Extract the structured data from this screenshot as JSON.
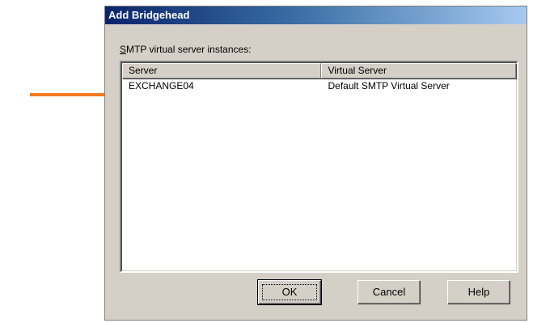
{
  "dialog": {
    "title": "Add Bridgehead",
    "list_caption_accel": "S",
    "list_caption_rest": "MTP virtual server instances:",
    "columns": [
      "Server",
      "Virtual Server"
    ],
    "rows": [
      {
        "server": "EXCHANGE04",
        "virtual_server": "Default SMTP Virtual Server"
      }
    ],
    "buttons": {
      "ok": "OK",
      "cancel": "Cancel",
      "help": "Help"
    }
  },
  "colors": {
    "annotation_arrow": "#f47b20",
    "title_bar": "#0a246a",
    "dialog_face": "#d4d0c8"
  },
  "icons": [
    "orange-pointer-arrow"
  ]
}
